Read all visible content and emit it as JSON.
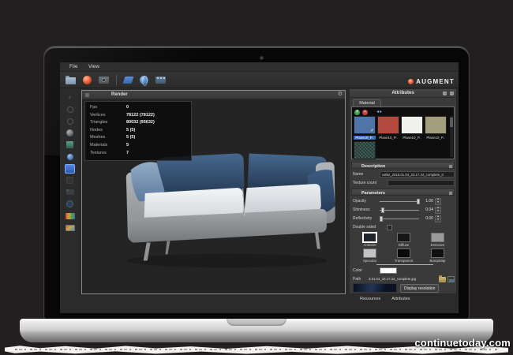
{
  "watermark": "continuetoday.com",
  "menu": {
    "items": [
      "File",
      "View"
    ]
  },
  "logo": {
    "text": "AUGMENT"
  },
  "viewport": {
    "title": "Render",
    "stats": {
      "rows": [
        {
          "label": "Fps",
          "value": "0"
        },
        {
          "label": "Vertices",
          "value": "78122 (78122)"
        },
        {
          "label": "Triangles",
          "value": "80032 (95632)"
        },
        {
          "label": "Nodes",
          "value": "5 (5)"
        },
        {
          "label": "Meshes",
          "value": "5 (5)"
        },
        {
          "label": "Materials",
          "value": "5"
        },
        {
          "label": "Textures",
          "value": "7"
        }
      ]
    }
  },
  "attributes": {
    "title": "Attributes",
    "material_tab": "Material",
    "materials": {
      "items": [
        {
          "label": "Plane10_P..",
          "color": "#4e74a8",
          "selected": true
        },
        {
          "label": "Plane10_P..",
          "color": "#b5493f",
          "selected": false
        },
        {
          "label": "Plane10_P..",
          "color": "#f0f0ec",
          "selected": false
        },
        {
          "label": "Plane10_P..",
          "color": "#a39d7b",
          "selected": false
        },
        {
          "label": "",
          "color": "#33504a",
          "selected": false
        }
      ],
      "check_glyph": "✓"
    },
    "description": {
      "title": "Description",
      "name_label": "Name",
      "name_value": "val92_2015.01.04_23.17.34_complete_0",
      "texture_count_label": "Texture count"
    },
    "parameters": {
      "title": "Parameters",
      "sliders": [
        {
          "label": "Opacity",
          "value": "1.00",
          "pos": "97%"
        },
        {
          "label": "Shininess",
          "value": "0.04",
          "pos": "8%"
        },
        {
          "label": "Reflectivity",
          "value": "0.00",
          "pos": "3%"
        }
      ],
      "double_sided_label": "Double sided",
      "maps": [
        {
          "label": "Ambient",
          "color": "#20242b",
          "selected": true
        },
        {
          "label": "Diffuse",
          "color": "#161616",
          "selected": false
        },
        {
          "label": "Emissive",
          "color": "#9a9a9a",
          "selected": false
        },
        {
          "label": "Specular",
          "color": "#c4c4c4",
          "selected": false
        },
        {
          "label": "Transparent",
          "color": "#0a0a0a",
          "selected": false
        },
        {
          "label": "BumpMap",
          "color": "#101010",
          "selected": false
        }
      ],
      "color_label": "Color",
      "color_value": "#ffffff",
      "path_label": "Path",
      "path_value": "3.01.04_23.17.34_complete.jpg",
      "display_resolution": "Display resolution"
    },
    "tabs": [
      "Resources",
      "Attributes"
    ]
  }
}
